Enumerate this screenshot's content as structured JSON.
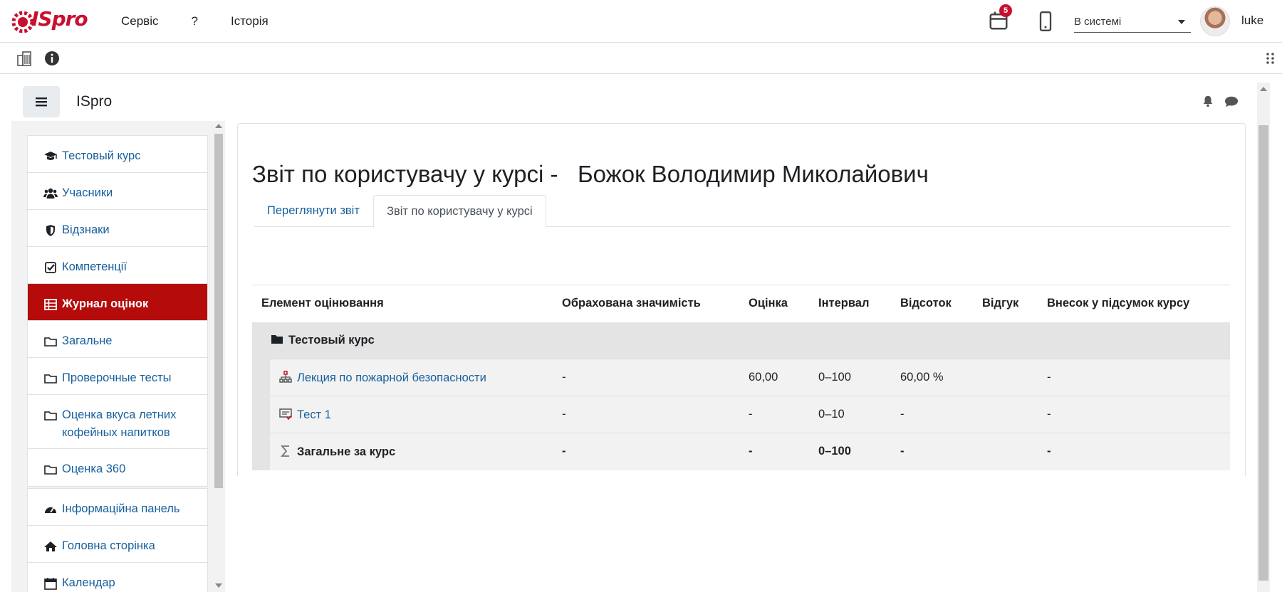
{
  "app": {
    "logo_text": "ISpro"
  },
  "topnav": {
    "items": [
      "Сервіс",
      "?",
      "Історія"
    ]
  },
  "topright": {
    "notifications_count": "5",
    "status_value": "В системі",
    "username": "luke"
  },
  "header": {
    "site_name": "ISpro"
  },
  "drawer": {
    "course_items": [
      {
        "label": "Тестовый курс",
        "icon": "graduation-cap-icon"
      },
      {
        "label": "Учасники",
        "icon": "users-icon"
      },
      {
        "label": "Відзнаки",
        "icon": "shield-icon"
      },
      {
        "label": "Компетенції",
        "icon": "check-square-icon"
      },
      {
        "label": "Журнал оцінок",
        "icon": "table-icon",
        "active": true
      },
      {
        "label": "Загальне",
        "icon": "folder-icon"
      },
      {
        "label": "Проверочные тесты",
        "icon": "folder-icon"
      },
      {
        "label": "Оценка вкуса летних кофейных напитков",
        "icon": "folder-icon"
      },
      {
        "label": "Оценка 360",
        "icon": "folder-icon"
      }
    ],
    "site_items": [
      {
        "label": "Інформаційна панель",
        "icon": "dashboard-icon"
      },
      {
        "label": "Головна сторінка",
        "icon": "home-icon"
      },
      {
        "label": "Календар",
        "icon": "calendar-icon"
      }
    ]
  },
  "main": {
    "title": "Звіт по користувачу у курсі -   Божок Володимир Миколайович",
    "tabs": [
      {
        "label": "Переглянути звіт",
        "active": false
      },
      {
        "label": "Звіт по користувачу у курсі",
        "active": true
      }
    ],
    "table": {
      "headers": [
        "Елемент оцінювання",
        "Обрахована значимість",
        "Оцінка",
        "Інтервал",
        "Відсоток",
        "Відгук",
        "Внесок у підсумок курсу"
      ],
      "category": "Тестовый курс",
      "rows": [
        {
          "name": "Лекция по пожарной безопасности",
          "weight": "-",
          "grade": "60,00",
          "range": "0–100",
          "percent": "60,00 %",
          "feedback": "",
          "contribution": "-"
        },
        {
          "name": "Тест 1",
          "weight": "-",
          "grade": "-",
          "range": "0–10",
          "percent": "-",
          "feedback": "",
          "contribution": "-"
        }
      ],
      "total": {
        "name": "Загальне за курс",
        "weight": "-",
        "grade": "-",
        "range": "0–100",
        "percent": "-",
        "feedback": "",
        "contribution": "-"
      }
    }
  },
  "colors": {
    "brand_red": "#c8102e",
    "active_nav": "#b50b0b",
    "link": "#17609d"
  }
}
